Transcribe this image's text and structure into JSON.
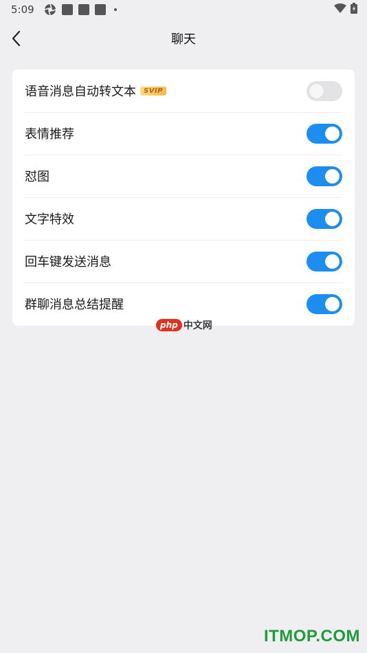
{
  "status_bar": {
    "time": "5:09",
    "icons": [
      "aperture-icon",
      "notification-square-icon",
      "notification-square-icon",
      "notification-square-icon",
      "more-dot-icon"
    ],
    "right_icons": [
      "wifi-icon",
      "battery-icon"
    ]
  },
  "nav": {
    "title": "聊天",
    "back_icon": "chevron-left-icon"
  },
  "settings": [
    {
      "label": "语音消息自动转文本",
      "badge": "SVIP",
      "enabled": false
    },
    {
      "label": "表情推荐",
      "enabled": true
    },
    {
      "label": "怼图",
      "enabled": true
    },
    {
      "label": "文字特效",
      "enabled": true
    },
    {
      "label": "回车键发送消息",
      "enabled": true
    },
    {
      "label": "群聊消息总结提醒",
      "enabled": true
    }
  ],
  "colors": {
    "toggle_on": "#1c8ef2",
    "toggle_off": "#e3e3e6",
    "background": "#efeff1"
  },
  "watermarks": {
    "php_badge": "php",
    "php_text": "中文网",
    "itmop": "ITMOP.COM"
  }
}
